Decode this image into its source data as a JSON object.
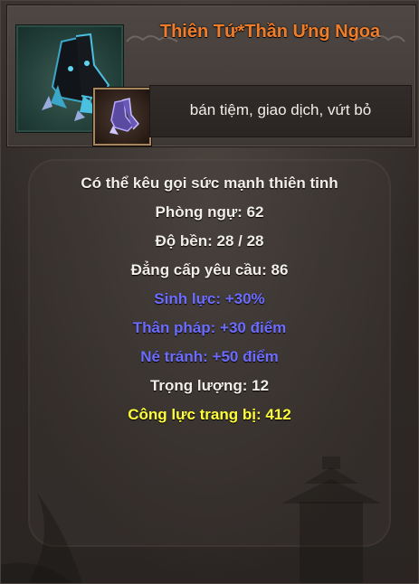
{
  "item": {
    "name": "Thiên Tứ*Thần Ưng Ngoa",
    "restrictions": "bán tiệm, giao dịch, vứt bỏ",
    "icon": "boots-icon",
    "thumbnail_icon": "boots-thumbnail-icon"
  },
  "stats": [
    {
      "text": "Có thể kêu gọi sức mạnh thiên tinh",
      "color": "#f2eeea"
    },
    {
      "text": "Phòng ngự: 62",
      "color": "#f2eeea"
    },
    {
      "text": "Độ bền:  28 /  28",
      "color": "#f2eeea"
    },
    {
      "text": "Đẳng cấp yêu cầu: 86",
      "color": "#f2eeea"
    },
    {
      "text": "Sinh lực: +30%",
      "color": "#6c6cff"
    },
    {
      "text": "Thân pháp: +30 điểm",
      "color": "#6c6cff"
    },
    {
      "text": "Né tránh: +50 điểm",
      "color": "#6c6cff"
    },
    {
      "text": "Trọng lượng: 12",
      "color": "#f2eeea"
    },
    {
      "text": "Công lực trang bị: 412",
      "color": "#ffff3b"
    }
  ],
  "colors": {
    "name": "#f07d2a",
    "normal": "#f2eeea",
    "magic": "#6c6cff",
    "power": "#ffff3b"
  }
}
